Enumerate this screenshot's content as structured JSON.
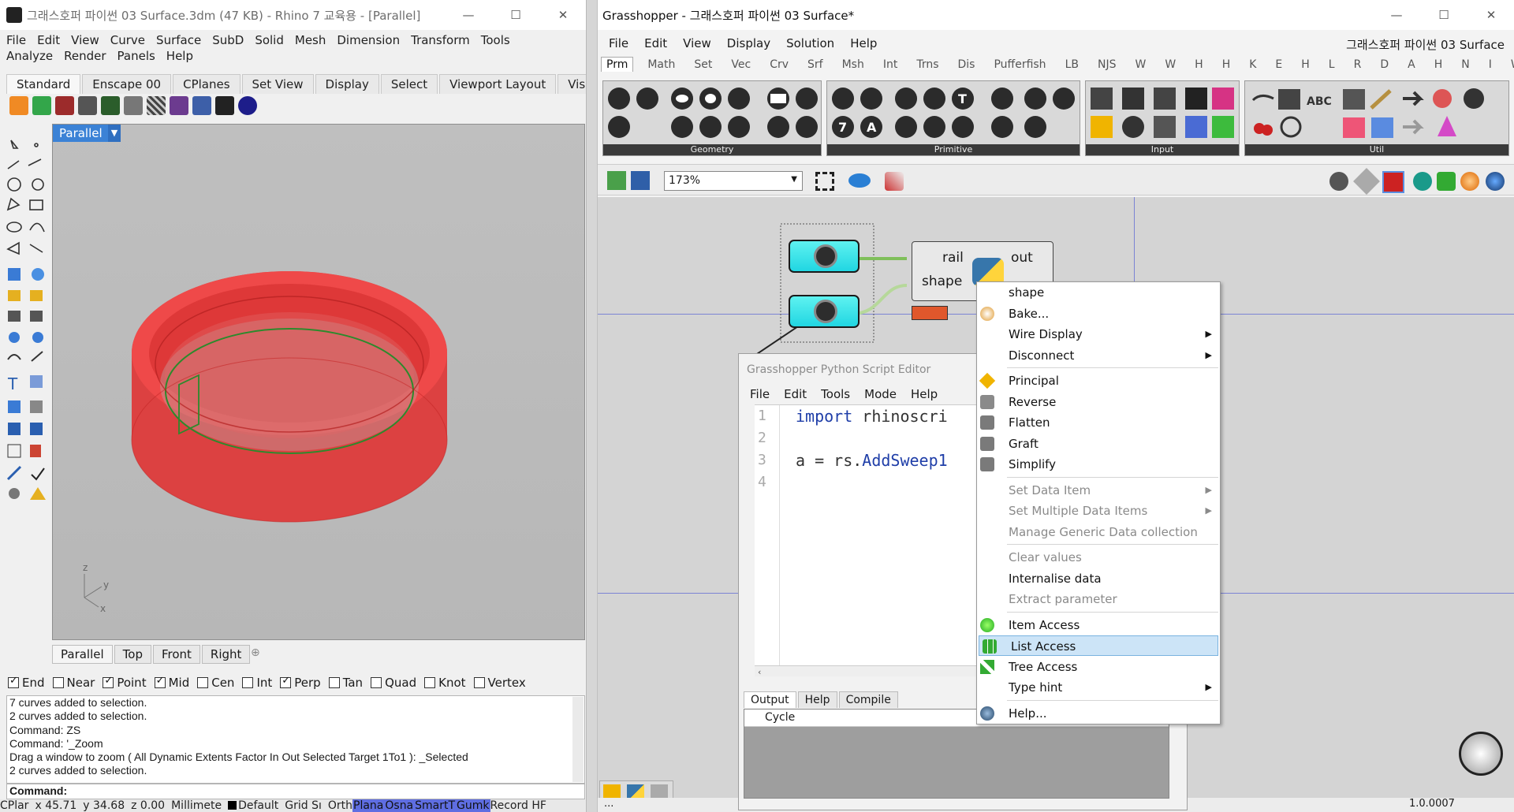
{
  "rhino": {
    "title": "그래스호퍼 파이썬 03 Surface.3dm (47 KB) - Rhino 7 교육용 - [Parallel]",
    "menu": [
      "File",
      "Edit",
      "View",
      "Curve",
      "Surface",
      "SubD",
      "Solid",
      "Mesh",
      "Dimension",
      "Transform",
      "Tools",
      "Analyze",
      "Render",
      "Panels",
      "Help"
    ],
    "tabs": [
      "Standard",
      "Enscape 00",
      "CPlanes",
      "Set View",
      "Display",
      "Select",
      "Viewport Layout",
      "Visi"
    ],
    "viewport": {
      "label": "Parallel",
      "axes": {
        "z": "z",
        "y": "y",
        "x": "x"
      },
      "ring_color": "#e8302e",
      "curve_color": "#2c8a2c"
    },
    "viewport_tabs": [
      "Parallel",
      "Top",
      "Front",
      "Right"
    ],
    "osnaps": [
      {
        "label": "End",
        "checked": true
      },
      {
        "label": "Near",
        "checked": false
      },
      {
        "label": "Point",
        "checked": true
      },
      {
        "label": "Mid",
        "checked": true
      },
      {
        "label": "Cen",
        "checked": false
      },
      {
        "label": "Int",
        "checked": false
      },
      {
        "label": "Perp",
        "checked": true
      },
      {
        "label": "Tan",
        "checked": false
      },
      {
        "label": "Quad",
        "checked": false
      },
      {
        "label": "Knot",
        "checked": false
      },
      {
        "label": "Vertex",
        "checked": false
      }
    ],
    "command_history": [
      "7 curves added to selection.",
      "2 curves added to selection.",
      "Command: ZS",
      "Command: '_Zoom",
      "Drag a window to zoom ( All  Dynamic  Extents  Factor  In  Out  Selected  Target  1To1 ): _Selected",
      "2 curves added to selection."
    ],
    "command_prompt": "Command:",
    "status": {
      "cplane": "CPlar",
      "x": "x 45.71",
      "y": "y 34.68",
      "z": "z 0.00",
      "units": "Millimete",
      "layer": "Default",
      "grid_snap": "Grid Sı",
      "ortho": "Orth",
      "planar": "Plana",
      "osnap": "Osna",
      "smarttrack": "SmartT",
      "gumball": "Gumk",
      "record": "Record HF"
    }
  },
  "gh": {
    "title": "Grasshopper - 그래스호퍼 파이썬 03 Surface*",
    "document": "그래스호퍼 파이썬 03 Surface",
    "menu": [
      "File",
      "Edit",
      "View",
      "Display",
      "Solution",
      "Help"
    ],
    "tabs": [
      "Prm",
      "Math",
      "Set",
      "Vec",
      "Crv",
      "Srf",
      "Msh",
      "Int",
      "Trns",
      "Dis",
      "Pufferfish",
      "LB",
      "NJS",
      "W",
      "W",
      "H",
      "H",
      "K",
      "E",
      "H",
      "L",
      "R",
      "D",
      "A",
      "H",
      "N",
      "I",
      "W"
    ],
    "ribbon_groups": [
      "Geometry",
      "Primitive",
      "Input",
      "Util"
    ],
    "zoom": "173%",
    "node": {
      "inputs": [
        "rail",
        "shape"
      ],
      "outputs": [
        "out"
      ]
    },
    "python_editor": {
      "title": "Grasshopper Python Script Editor",
      "menu": [
        "File",
        "Edit",
        "Tools",
        "Mode",
        "Help"
      ],
      "line_numbers": [
        "1",
        "2",
        "3",
        "4"
      ],
      "code_line1_kw": "import",
      "code_line1_rest": " rhinoscri",
      "code_line3_a": "a = rs.",
      "code_line3_fn": "AddSweep1",
      "bottom_tabs": [
        "Output",
        "Help",
        "Compile"
      ],
      "output_header": "Cycle"
    },
    "context_menu": {
      "items": [
        {
          "label": "shape",
          "disabled": false,
          "icon": ""
        },
        {
          "label": "Bake...",
          "disabled": false,
          "icon": "bake-icon"
        },
        {
          "label": "Wire Display",
          "disabled": false,
          "submenu": true
        },
        {
          "label": "Disconnect",
          "disabled": false,
          "submenu": true
        },
        {
          "label": "Principal",
          "disabled": false,
          "icon": "principal-icon"
        },
        {
          "label": "Reverse",
          "disabled": false,
          "icon": "reverse-icon"
        },
        {
          "label": "Flatten",
          "disabled": false,
          "icon": "flatten-icon"
        },
        {
          "label": "Graft",
          "disabled": false,
          "icon": "graft-icon"
        },
        {
          "label": "Simplify",
          "disabled": false,
          "icon": "simplify-icon"
        },
        {
          "label": "Set Data Item",
          "disabled": true,
          "submenu": true
        },
        {
          "label": "Set Multiple Data Items",
          "disabled": true,
          "submenu": true
        },
        {
          "label": "Manage Generic Data collection",
          "disabled": true
        },
        {
          "label": "Clear values",
          "disabled": true
        },
        {
          "label": "Internalise data",
          "disabled": false
        },
        {
          "label": "Extract parameter",
          "disabled": true
        },
        {
          "label": "Item Access",
          "disabled": false,
          "icon": "item-access-icon"
        },
        {
          "label": "List Access",
          "disabled": false,
          "icon": "list-access-icon",
          "highlighted": true
        },
        {
          "label": "Tree Access",
          "disabled": false,
          "icon": "tree-access-icon"
        },
        {
          "label": "Type hint",
          "disabled": false,
          "submenu": true
        },
        {
          "label": "Help...",
          "disabled": false,
          "icon": "help-icon"
        }
      ]
    },
    "status_left": "...",
    "version": "1.0.0007"
  }
}
